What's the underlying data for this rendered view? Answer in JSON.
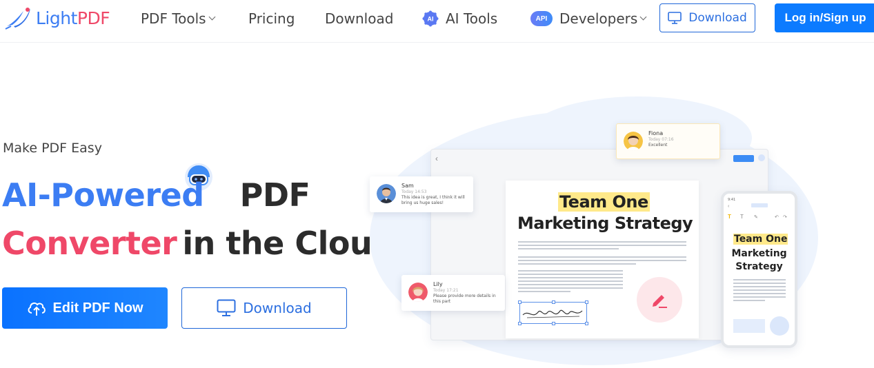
{
  "brand": {
    "name_part1": "Light",
    "name_part2": "PDF"
  },
  "nav": {
    "pdf_tools": "PDF Tools",
    "pricing": "Pricing",
    "download": "Download",
    "ai_tools": "AI Tools",
    "developers": "Developers",
    "api_badge": "API"
  },
  "header_buttons": {
    "download": "Download",
    "login": "Log in/Sign up"
  },
  "hero": {
    "tagline": "Make PDF Easy",
    "title_ai_powered": "AI-Powered",
    "title_pdf": "PDF",
    "title_converter": "Converter",
    "title_in_the_cloud": "in the Cloud",
    "edit_button": "Edit PDF Now",
    "download_button": "Download"
  },
  "illustration": {
    "doc_title_highlight": "Team One",
    "doc_title_rest": "Marketing Strategy",
    "phone_title_highlight": "Team One",
    "phone_title_rest": "Marketing Strategy",
    "comments": [
      {
        "name": "Fiona",
        "time": "Today 07:16",
        "message": "Excellent"
      },
      {
        "name": "Sam",
        "time": "Today 14:53",
        "message": "This idea is great, I think it will bring us huge sales!"
      },
      {
        "name": "Lily",
        "time": "Today 17:21",
        "message": "Please provide more details in this part"
      }
    ]
  },
  "colors": {
    "brand_blue": "#3c7df3",
    "brand_red": "#ef4868",
    "primary_button": "#0c7bff",
    "highlight_yellow": "#ffe98a"
  }
}
